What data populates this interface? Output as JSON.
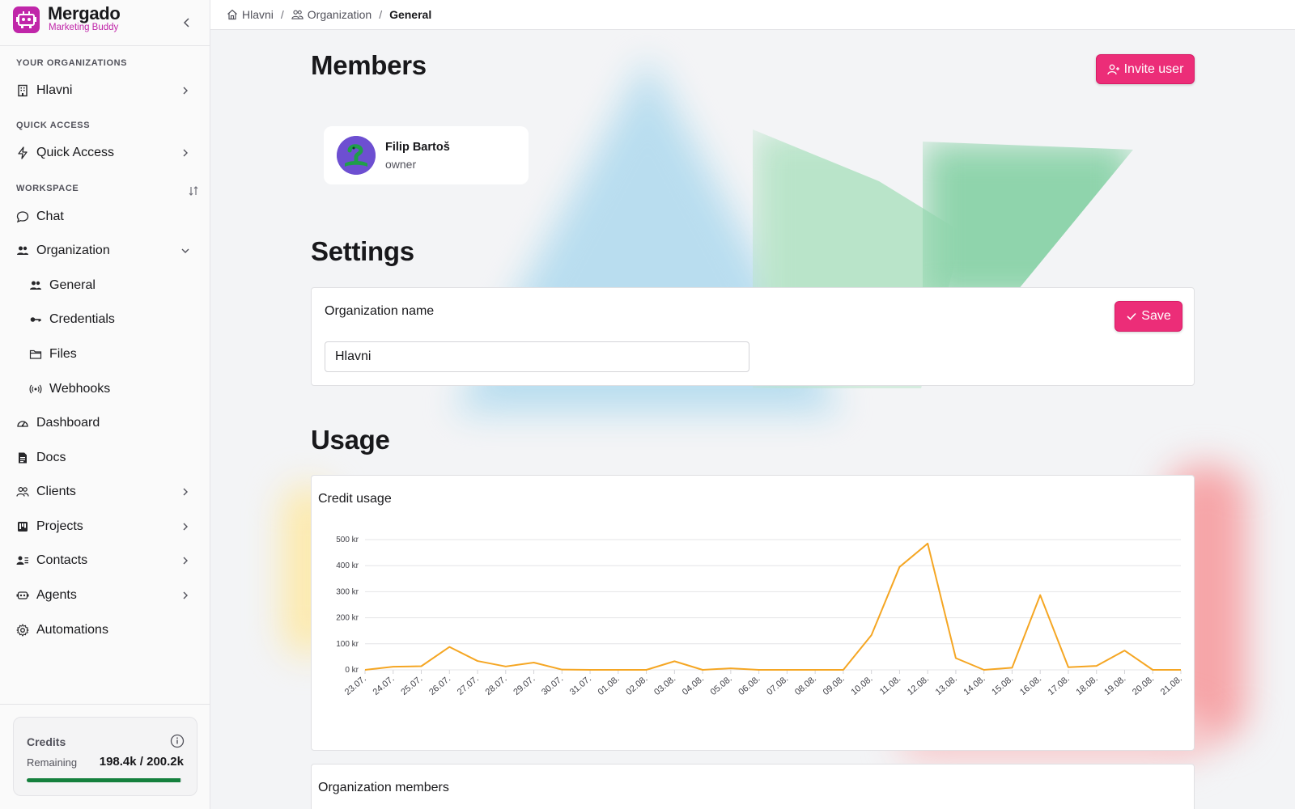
{
  "brand": {
    "name": "Mergado",
    "subtitle": "Marketing Buddy"
  },
  "breadcrumb": [
    {
      "label": "Hlavni",
      "icon": "home-icon"
    },
    {
      "label": "Organization",
      "icon": "users-icon"
    },
    {
      "label": "General"
    }
  ],
  "breadcrumb_sep": "/",
  "sidebar": {
    "your_orgs_label": "YOUR ORGANIZATIONS",
    "org_item": "Hlavni",
    "quick_label": "QUICK ACCESS",
    "quick_item": "Quick Access",
    "workspace_label": "WORKSPACE",
    "items": {
      "chat": "Chat",
      "organization": "Organization",
      "general": "General",
      "credentials": "Credentials",
      "files": "Files",
      "webhooks": "Webhooks",
      "dashboard": "Dashboard",
      "docs": "Docs",
      "clients": "Clients",
      "projects": "Projects",
      "contacts": "Contacts",
      "agents": "Agents",
      "automations": "Automations"
    }
  },
  "credits": {
    "title": "Credits",
    "remaining_label": "Remaining",
    "value": "198.4k / 200.2k",
    "fraction": 0.991
  },
  "members": {
    "title": "Members",
    "invite_label": "Invite user",
    "list": [
      {
        "name": "Filip Bartoš",
        "role": "owner"
      }
    ]
  },
  "settings": {
    "title": "Settings",
    "org_name_label": "Organization name",
    "org_name_value": "Hlavni",
    "save_label": "Save"
  },
  "usage": {
    "title": "Usage",
    "org_members_label": "Organization members"
  },
  "colors": {
    "accent": "#ec2d78",
    "brand": "#c026a9",
    "line": "#f5a623",
    "progress": "#15803d"
  },
  "chart_data": {
    "type": "line",
    "title": "Credit usage",
    "x": [
      "23.07.",
      "24.07.",
      "25.07.",
      "26.07.",
      "27.07.",
      "28.07.",
      "29.07.",
      "30.07.",
      "31.07.",
      "01.08.",
      "02.08.",
      "03.08.",
      "04.08.",
      "05.08.",
      "06.08.",
      "07.08.",
      "08.08.",
      "09.08.",
      "10.08.",
      "11.08.",
      "12.08.",
      "13.08.",
      "14.08.",
      "15.08.",
      "16.08.",
      "17.08.",
      "18.08.",
      "19.08.",
      "20.08.",
      "21.08."
    ],
    "values": [
      0,
      12,
      14,
      88,
      34,
      13,
      28,
      1,
      0,
      0,
      0,
      33,
      0,
      6,
      0,
      0,
      0,
      0,
      133,
      395,
      485,
      45,
      0,
      8,
      287,
      10,
      15,
      74,
      0,
      0
    ],
    "yticks": [
      "0 kr",
      "100 kr",
      "200 kr",
      "300 kr",
      "400 kr",
      "500 kr"
    ],
    "ylim": [
      0,
      500
    ],
    "grid": true
  }
}
